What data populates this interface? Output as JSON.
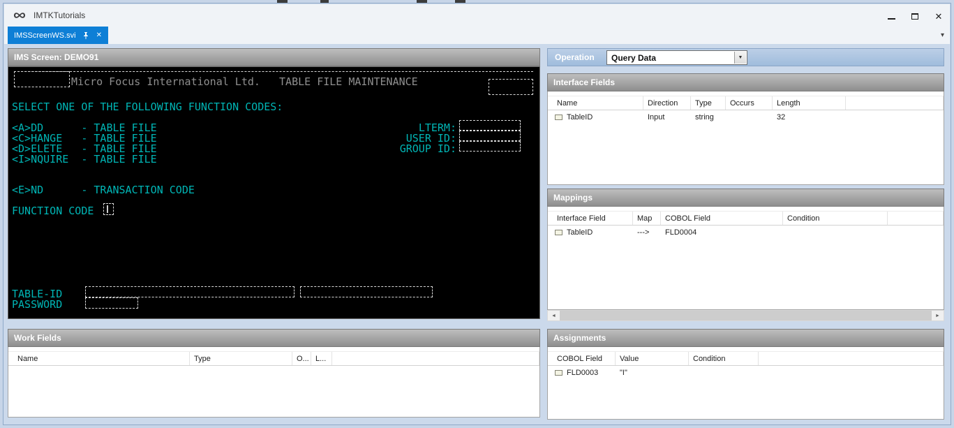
{
  "window": {
    "title": "IMTKTutorials"
  },
  "tabs": {
    "active": {
      "label": "IMSScreenWS.svi"
    }
  },
  "icons": {
    "close_window": "✕",
    "tab_close": "✕",
    "tab_overflow": "▾",
    "dropdown_arrow": "▼",
    "scroll_left": "◄",
    "scroll_right": "►"
  },
  "colors": {
    "tab_active": "#0e7fd6",
    "terminal_text": "#00b5b5",
    "terminal_banner": "#8f8f8f",
    "section_header_top": "#bebebe",
    "section_header_bottom": "#8e8e8e",
    "operation_bar": "#a9c2de"
  },
  "operation": {
    "label": "Operation",
    "value": "Query Data"
  },
  "ims_screen": {
    "title": "IMS Screen: DEMO91",
    "banner": "Micro Focus International Ltd.   TABLE FILE MAINTENANCE",
    "prompt": "SELECT ONE OF THE FOLLOWING FUNCTION CODES:",
    "options": [
      "<A>DD      - TABLE FILE",
      "<C>HANGE   - TABLE FILE",
      "<D>ELETE   - TABLE FILE",
      "<I>NQUIRE  - TABLE FILE"
    ],
    "end_option": "<E>ND      - TRANSACTION CODE",
    "labels": {
      "lterm": "LTERM:",
      "user_id": "USER ID:",
      "group_id": "GROUP ID:",
      "function_code": "FUNCTION CODE",
      "table_id": "TABLE-ID",
      "password": "PASSWORD"
    }
  },
  "interface_fields": {
    "title": "Interface Fields",
    "columns": [
      "Name",
      "Direction",
      "Type",
      "Occurs",
      "Length"
    ],
    "rows": [
      {
        "name": "TableID",
        "direction": "Input",
        "type": "string",
        "occurs": "",
        "length": "32"
      }
    ]
  },
  "mappings": {
    "title": "Mappings",
    "columns": [
      "Interface Field",
      "Map",
      "COBOL Field",
      "Condition"
    ],
    "rows": [
      {
        "interface_field": "TableID",
        "map": "--->",
        "cobol_field": "FLD0004",
        "condition": ""
      }
    ]
  },
  "work_fields": {
    "title": "Work Fields",
    "columns": [
      "Name",
      "Type",
      "O...",
      "L..."
    ]
  },
  "assignments": {
    "title": "Assignments",
    "columns": [
      "COBOL Field",
      "Value",
      "Condition"
    ],
    "rows": [
      {
        "cobol_field": "FLD0003",
        "value": "\"I\"",
        "condition": ""
      }
    ]
  }
}
